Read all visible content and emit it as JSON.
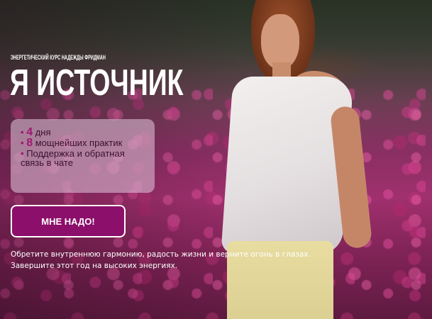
{
  "hero": {
    "eyebrow": "ЭНЕРГЕТИЧЕСКИЙ КУРС НАДЕЖДЫ ФРИДМАН",
    "title": "Я ИСТОЧНИК",
    "features": [
      {
        "bullet": "•",
        "number": "4",
        "text": "дня"
      },
      {
        "bullet": "•",
        "number": "8",
        "text": "мощнейших практик"
      },
      {
        "bullet": "•",
        "number": "",
        "text": "Поддержка и обратная связь в чате"
      }
    ],
    "cta_label": "МНЕ НАДО!",
    "description_line1": "Обретите внутреннюю гармонию, радость жизни и верните огонь в глазах.",
    "description_line2": "Завершите этот год на высоких энергиях."
  },
  "colors": {
    "accent": "#8c0f6b",
    "accent_text": "#a0176f",
    "panel": "rgba(225,200,220,0.55)",
    "text_light": "#ffffff"
  }
}
